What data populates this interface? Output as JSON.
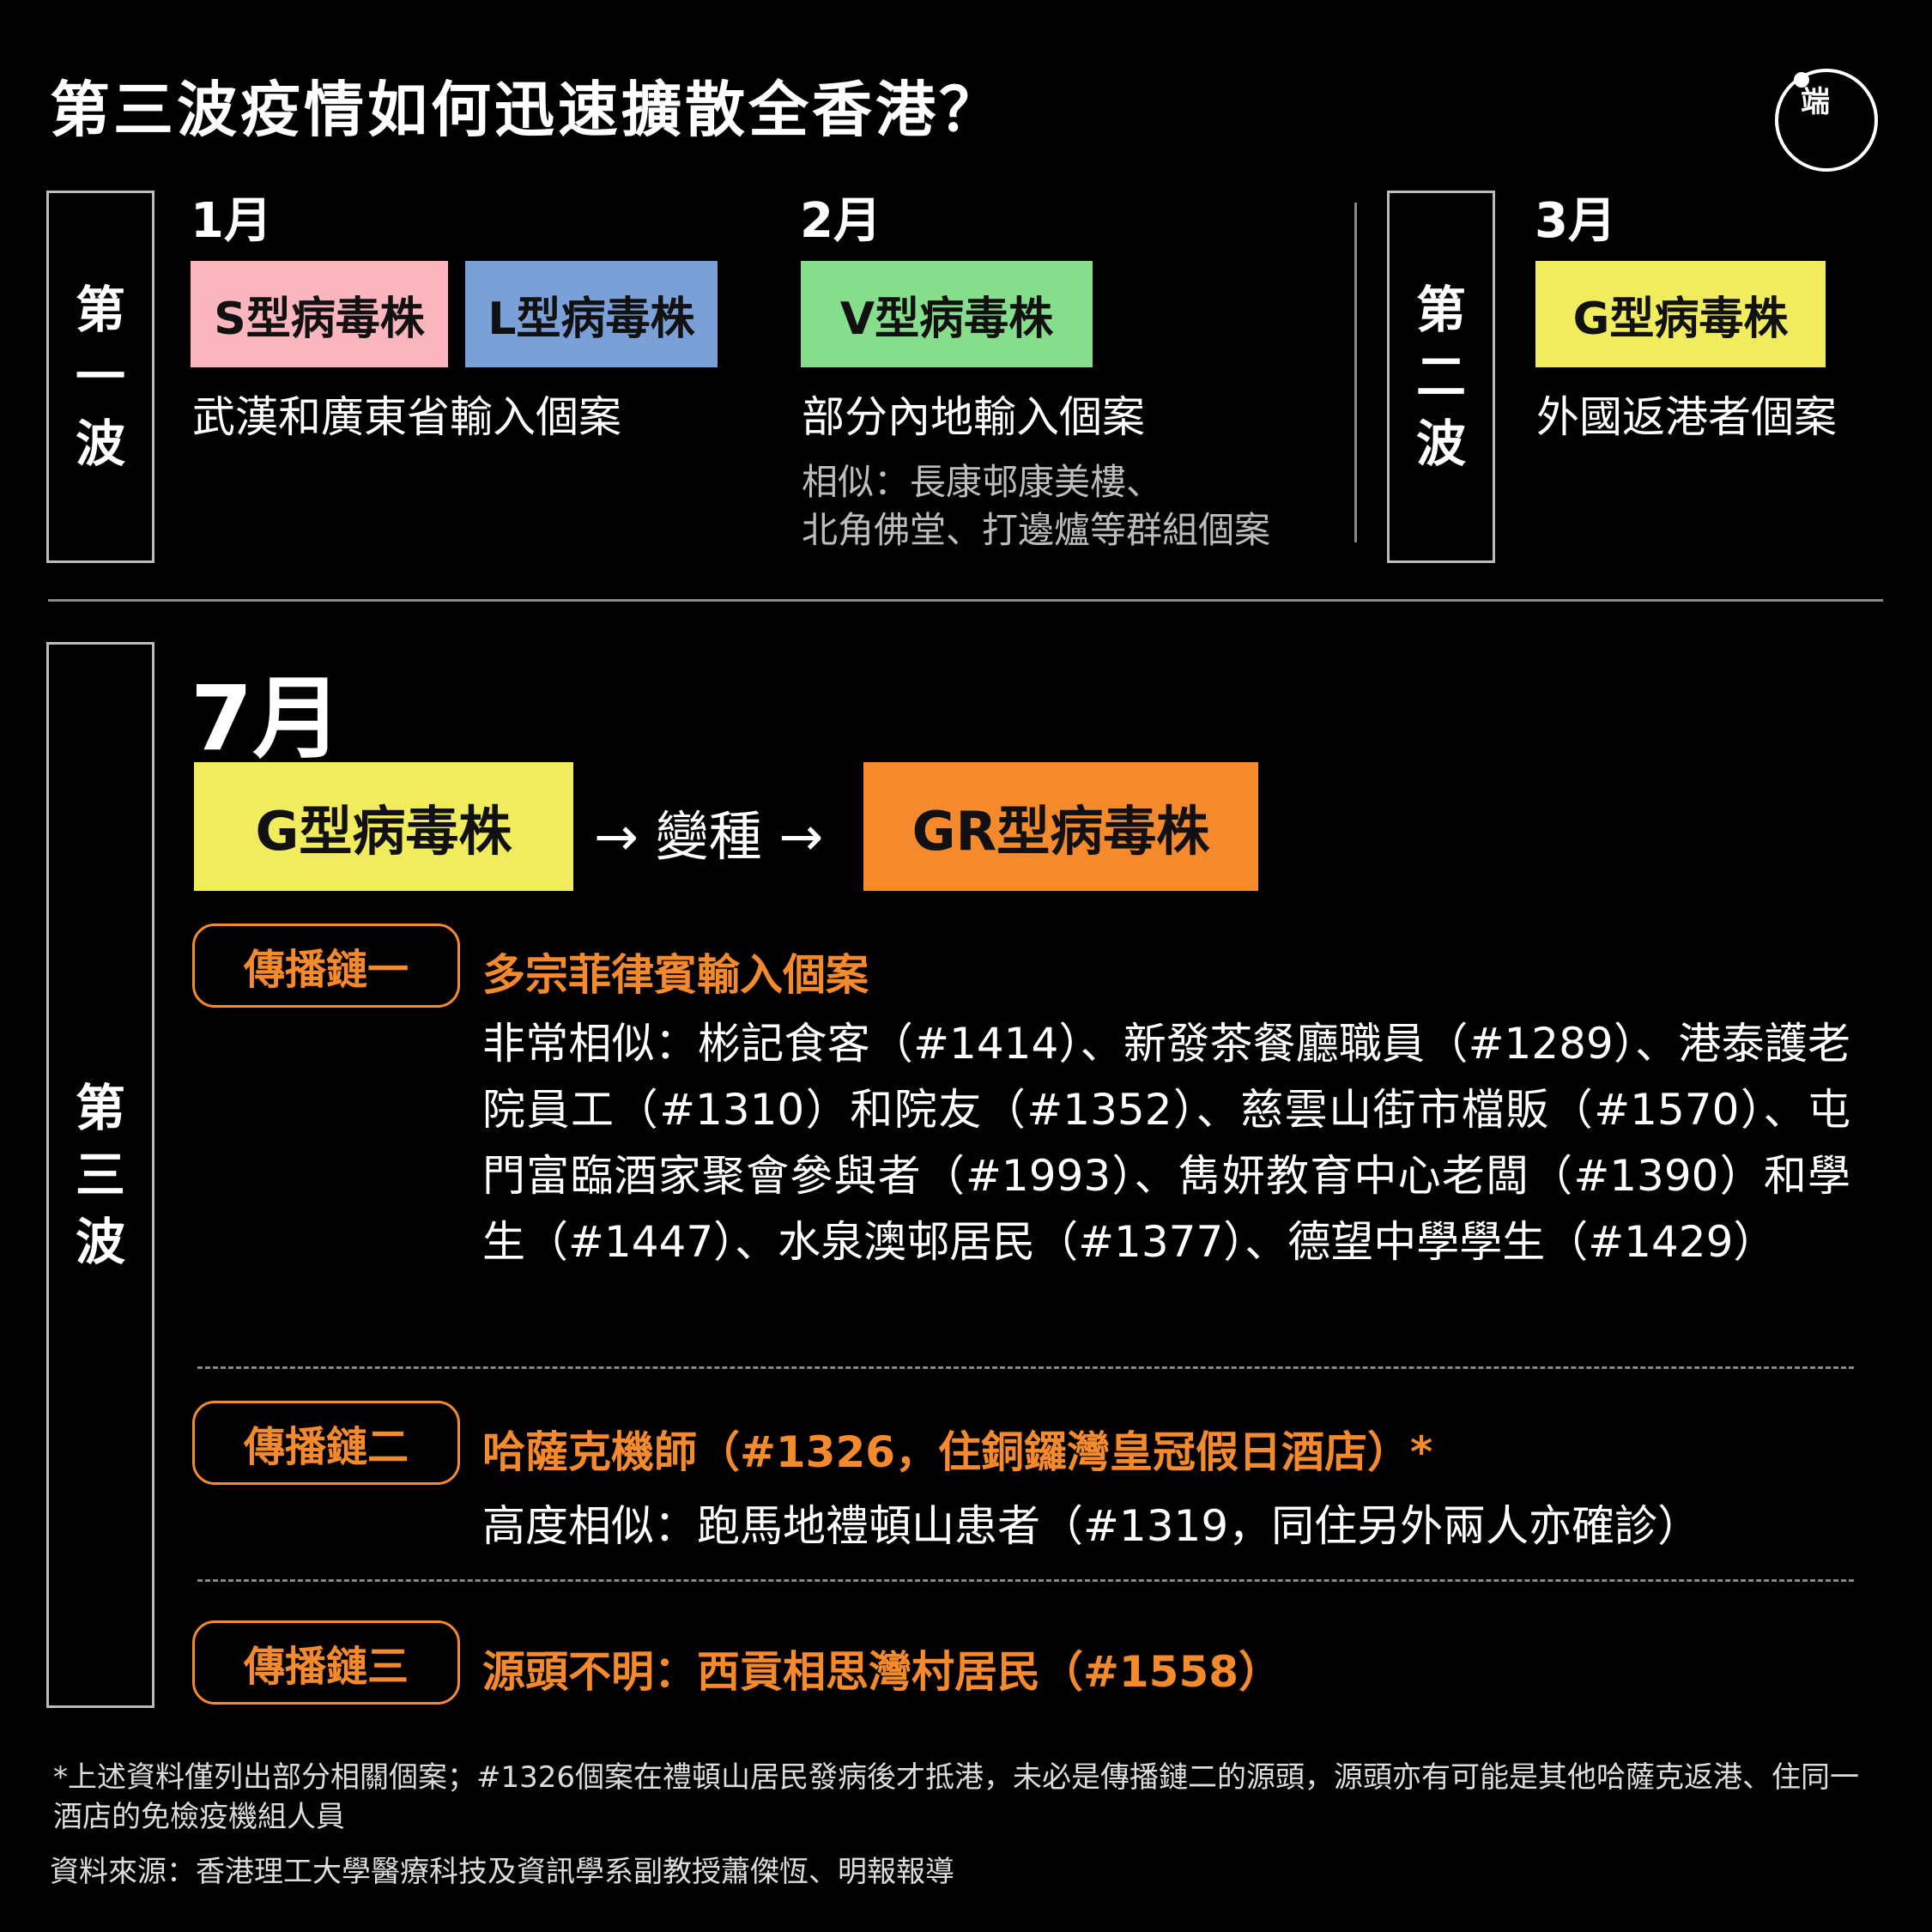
{
  "title": "第三波疫情如何迅速擴散全香港？",
  "logo": {
    "text": "端"
  },
  "colors": {
    "S": "#fbb5be",
    "L": "#7ba0d8",
    "V": "#86de8d",
    "G": "#f0ec5e",
    "GR": "#f58a2c",
    "chain": "#f58a2c"
  },
  "wave1": {
    "label": [
      "第",
      "一",
      "波"
    ],
    "jan": {
      "month": "1月",
      "strain_s": "S型病毒株",
      "strain_l": "L型病毒株",
      "desc": "武漢和廣東省輸入個案"
    },
    "feb": {
      "month": "2月",
      "strain_v": "V型病毒株",
      "desc": "部分內地輸入個案",
      "note_line1": "相似：長康邨康美樓、",
      "note_line2": "北角佛堂、打邊爐等群組個案"
    }
  },
  "wave2": {
    "label": [
      "第",
      "二",
      "波"
    ],
    "mar": {
      "month": "3月",
      "strain_g": "G型病毒株",
      "desc": "外國返港者個案"
    }
  },
  "wave3": {
    "label": [
      "第",
      "三",
      "波"
    ],
    "month": "7月",
    "strain_g": "G型病毒株",
    "mutation": "→ 變種 →",
    "strain_gr": "GR型病毒株",
    "chain1": {
      "label": "傳播鏈一",
      "headline": "多宗菲律賓輸入個案",
      "body": "非常相似：彬記食客（#1414）、新發茶餐廳職員（#1289）、港泰護老院員工（#1310）和院友（#1352）、慈雲山街市檔販（#1570）、屯門富臨酒家聚會參與者（#1993）、雋妍教育中心老闆（#1390）和學生（#1447）、水泉澳邨居民（#1377）、德望中學學生（#1429）"
    },
    "chain2": {
      "label": "傳播鏈二",
      "headline": "哈薩克機師（#1326，住銅鑼灣皇冠假日酒店）*",
      "body": "高度相似：跑馬地禮頓山患者（#1319，同住另外兩人亦確診）"
    },
    "chain3": {
      "label": "傳播鏈三",
      "headline": "源頭不明：西貢相思灣村居民（#1558）"
    }
  },
  "footnote": "*上述資料僅列出部分相關個案；#1326個案在禮頓山居民發病後才抵港，未必是傳播鏈二的源頭，源頭亦有可能是其他哈薩克返港、住同一酒店的免檢疫機組人員",
  "source": "資料來源：香港理工大學醫療科技及資訊學系副教授蕭傑恆、明報報導"
}
